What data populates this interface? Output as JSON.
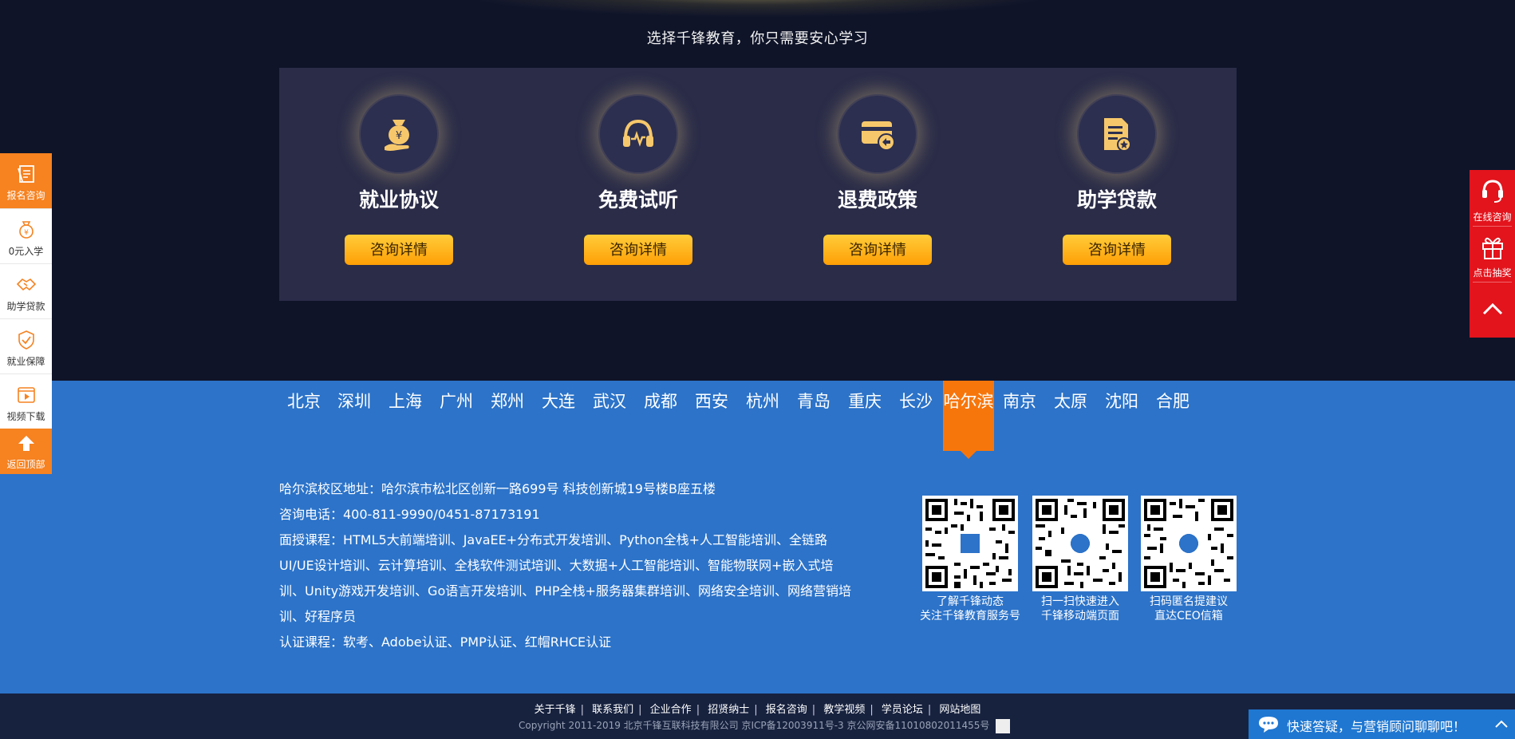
{
  "tagline": "选择千锋教育，你只需要安心学习",
  "features": [
    {
      "icon": "money-bag-icon",
      "title": "就业协议",
      "button": "咨询详情"
    },
    {
      "icon": "headphones-icon",
      "title": "免费试听",
      "button": "咨询详情"
    },
    {
      "icon": "refund-card-icon",
      "title": "退费政策",
      "button": "咨询详情"
    },
    {
      "icon": "document-icon",
      "title": "助学贷款",
      "button": "咨询详情"
    }
  ],
  "cities": [
    "北京",
    "深圳",
    "上海",
    "广州",
    "郑州",
    "大连",
    "武汉",
    "成都",
    "西安",
    "杭州",
    "青岛",
    "重庆",
    "长沙",
    "哈尔滨",
    "南京",
    "太原",
    "沈阳",
    "合肥"
  ],
  "active_city": "哈尔滨",
  "campus": {
    "address": "哈尔滨校区地址：哈尔滨市松北区创新一路699号 科技创新城19号楼B座五楼",
    "phone": "咨询电话：400-811-9990/0451-87173191",
    "courses_line1": "面授课程：HTML5大前端培训、JavaEE+分布式开发培训、Python全栈+人工智能培训、全链路",
    "courses_line2": "UI/UE设计培训、云计算培训、全栈软件测试培训、大数据+人工智能培训、智能物联网+嵌入式培",
    "courses_line3": "训、Unity游戏开发培训、Go语言开发培训、PHP全栈+服务器集群培训、网络安全培训、网络营销培",
    "courses_line4": "训、好程序员",
    "certs": "认证课程：软考、Adobe认证、PMP认证、红帽RHCE认证"
  },
  "qrcodes": [
    {
      "line1": "了解千锋动态",
      "line2": "关注千锋教育服务号"
    },
    {
      "line1": "扫一扫快速进入",
      "line2": "千锋移动端页面"
    },
    {
      "line1": "扫码匿名提建议",
      "line2": "直达CEO信箱"
    }
  ],
  "footer_links": [
    "关于千锋",
    "联系我们",
    "企业合作",
    "招贤纳士",
    "报名咨询",
    "教学视频",
    "学员论坛",
    "网站地图"
  ],
  "copyright": "Copyright 2011-2019  北京千锋互联科技有限公司  京ICP备12003911号-3  京公网安备11010802011455号",
  "left_sidebar": [
    {
      "label": "报名咨询",
      "icon": "signup-form-icon",
      "highlight": true
    },
    {
      "label": "0元入学",
      "icon": "money-bag-icon",
      "highlight": false
    },
    {
      "label": "助学贷款",
      "icon": "handshake-icon",
      "highlight": false
    },
    {
      "label": "就业保障",
      "icon": "shield-check-icon",
      "highlight": false
    },
    {
      "label": "视频下载",
      "icon": "video-icon",
      "highlight": false
    },
    {
      "label": "返回顶部",
      "icon": "arrow-up-icon",
      "highlight": true
    }
  ],
  "right_sidebar": [
    {
      "label": "在线咨询",
      "icon": "headset-icon"
    },
    {
      "label": "点击抽奖",
      "icon": "gift-icon"
    },
    {
      "label": "",
      "icon": "chevron-up-icon"
    }
  ],
  "chat_bar": {
    "text": "快速答疑，与营销顾问聊聊吧！",
    "icon": "chat-bubble-icon"
  },
  "colors": {
    "page_bg": "#0f1429",
    "panel_bg": "#2a2c48",
    "footer_blue": "#2c73c9",
    "accent_orange": "#f7760c",
    "button_gold": "#ffb21a",
    "sidebar_red": "#e3141c",
    "chat_blue": "#1f77d1"
  }
}
